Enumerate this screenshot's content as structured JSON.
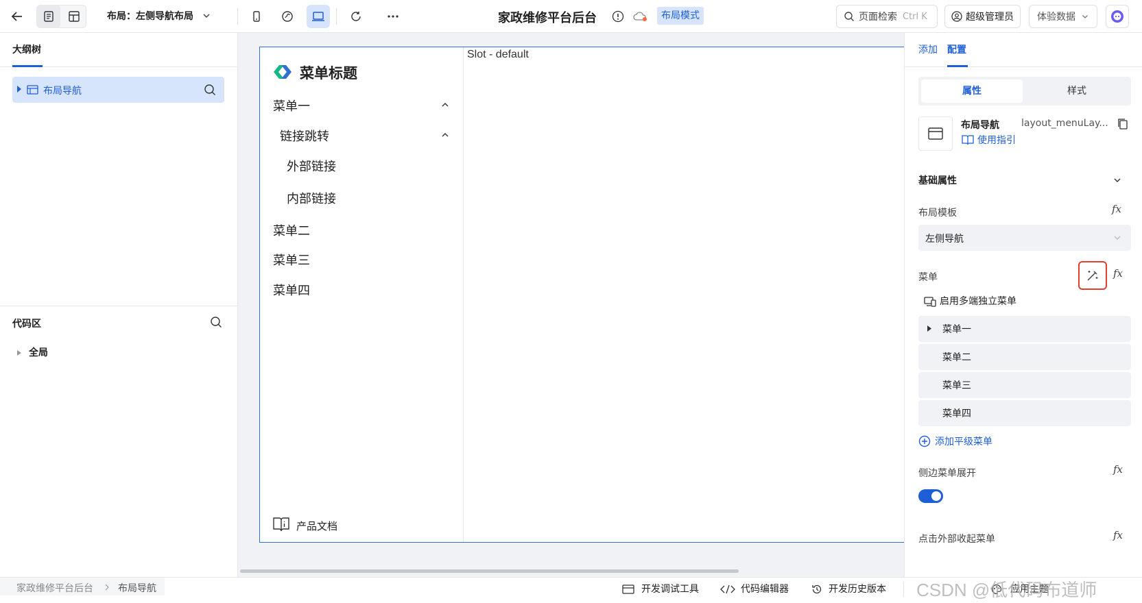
{
  "topbar": {
    "layout_label": "布局：左侧导航布局",
    "app_title": "家政维修平台后台",
    "mode_badge": "布局模式",
    "search_placeholder": "页面检索",
    "search_shortcut": "Ctrl K",
    "user_role": "超级管理员",
    "data_select": "体验数据"
  },
  "left": {
    "outline_tab": "大纲树",
    "tree_node": "布局导航",
    "code_area_title": "代码区",
    "code_tree_node": "全局"
  },
  "canvas": {
    "menu_title": "菜单标题",
    "menu_items": [
      "菜单一",
      "链接跳转",
      "外部链接",
      "内部链接",
      "菜单二",
      "菜单三",
      "菜单四"
    ],
    "footer_link": "产品文档",
    "slot_label": "Slot - default"
  },
  "right": {
    "tabs": [
      "添加",
      "配置"
    ],
    "segment": [
      "属性",
      "样式"
    ],
    "component_name": "布局导航",
    "component_id": "layout_menuLay...",
    "guide_link": "使用指引",
    "section_basic": "基础属性",
    "layout_template_label": "布局模板",
    "layout_template_value": "左侧导航",
    "menu_label": "菜单",
    "multi_menu": "启用多端独立菜单",
    "menus": [
      "菜单一",
      "菜单二",
      "菜单三",
      "菜单四"
    ],
    "add_menu": "添加平级菜单",
    "sidebar_expand_label": "侧边菜单展开",
    "sidebar_expand_on": true,
    "click_outside_label": "点击外部收起菜单"
  },
  "bottom": {
    "breadcrumb": [
      "家政维修平台后台",
      "布局导航"
    ],
    "tools": [
      "开发调试工具",
      "代码编辑器",
      "开发历史版本",
      "应用主题"
    ],
    "watermark": "CSDN @低代码布道师"
  },
  "colors": {
    "accent": "#1f5fd6",
    "selected_bg": "#d6e4fc",
    "highlight_border": "#e0402e",
    "panel_bg": "#f0f2f5"
  }
}
